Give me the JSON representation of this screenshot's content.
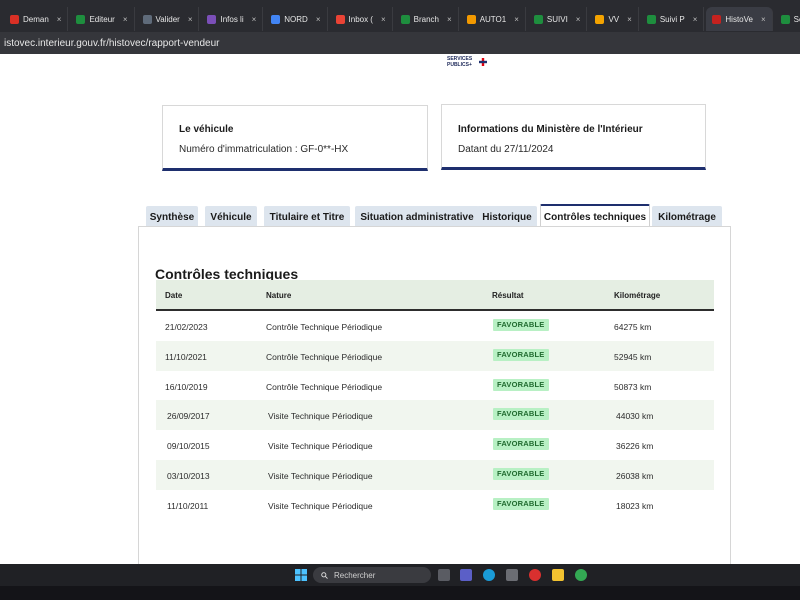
{
  "browser": {
    "tabs": [
      {
        "label": "Deman",
        "color": "#d93025"
      },
      {
        "label": "Editeur",
        "color": "#1e8e3e"
      },
      {
        "label": "Valider",
        "color": "#5f6b7a"
      },
      {
        "label": "Infos li",
        "color": "#7b4fb8"
      },
      {
        "label": "NORD",
        "color": "#4285f4"
      },
      {
        "label": "Inbox (",
        "color": "#ea4335"
      },
      {
        "label": "Branch",
        "color": "#1e8e3e"
      },
      {
        "label": "AUTO1",
        "color": "#f29900"
      },
      {
        "label": "SUIVI",
        "color": "#1e8e3e"
      },
      {
        "label": "VV",
        "color": "#f4a300"
      },
      {
        "label": "Suivi P",
        "color": "#1e8e3e"
      },
      {
        "label": "HistoVe",
        "color": "#c5221f"
      },
      {
        "label": "Service",
        "color": "#1e8e3e"
      }
    ],
    "url": "istovec.interieur.gouv.fr/histovec/rapport-vendeur"
  },
  "logo": {
    "line1": "SERVICES",
    "line2": "PUBLICS+"
  },
  "vehicle_card": {
    "title": "Le véhicule",
    "plate_text": "Numéro d'immatriculation : GF-0**-HX"
  },
  "ministry_card": {
    "title": "Informations du Ministère de l'Intérieur",
    "date_text": "Datant du 27/11/2024"
  },
  "tabs": [
    {
      "label": "Synthèse"
    },
    {
      "label": "Véhicule"
    },
    {
      "label": "Titulaire et Titre"
    },
    {
      "label": "Situation administrative"
    },
    {
      "label": "Historique"
    },
    {
      "label": "Contrôles techniques"
    },
    {
      "label": "Kilométrage"
    }
  ],
  "active_tab": "Contrôles techniques",
  "section_title": "Contrôles techniques",
  "table": {
    "headers": {
      "date": "Date",
      "nature": "Nature",
      "result": "Résultat",
      "mileage": "Kilométrage"
    },
    "rows": [
      {
        "date": "21/02/2023",
        "nature": "Contrôle Technique Périodique",
        "result": "FAVORABLE",
        "mileage": "64275 km"
      },
      {
        "date": "11/10/2021",
        "nature": "Contrôle Technique Périodique",
        "result": "FAVORABLE",
        "mileage": "52945 km"
      },
      {
        "date": "16/10/2019",
        "nature": "Contrôle Technique Périodique",
        "result": "FAVORABLE",
        "mileage": "50873 km"
      },
      {
        "date": "26/09/2017",
        "nature": "Visite Technique Périodique",
        "result": "FAVORABLE",
        "mileage": "44030 km"
      },
      {
        "date": "09/10/2015",
        "nature": "Visite Technique Périodique",
        "result": "FAVORABLE",
        "mileage": "36226 km"
      },
      {
        "date": "03/10/2013",
        "nature": "Visite Technique Périodique",
        "result": "FAVORABLE",
        "mileage": "26038 km"
      },
      {
        "date": "11/10/2011",
        "nature": "Visite Technique Périodique",
        "result": "FAVORABLE",
        "mileage": "18023 km"
      }
    ]
  },
  "taskbar": {
    "search_placeholder": "Rechercher"
  }
}
